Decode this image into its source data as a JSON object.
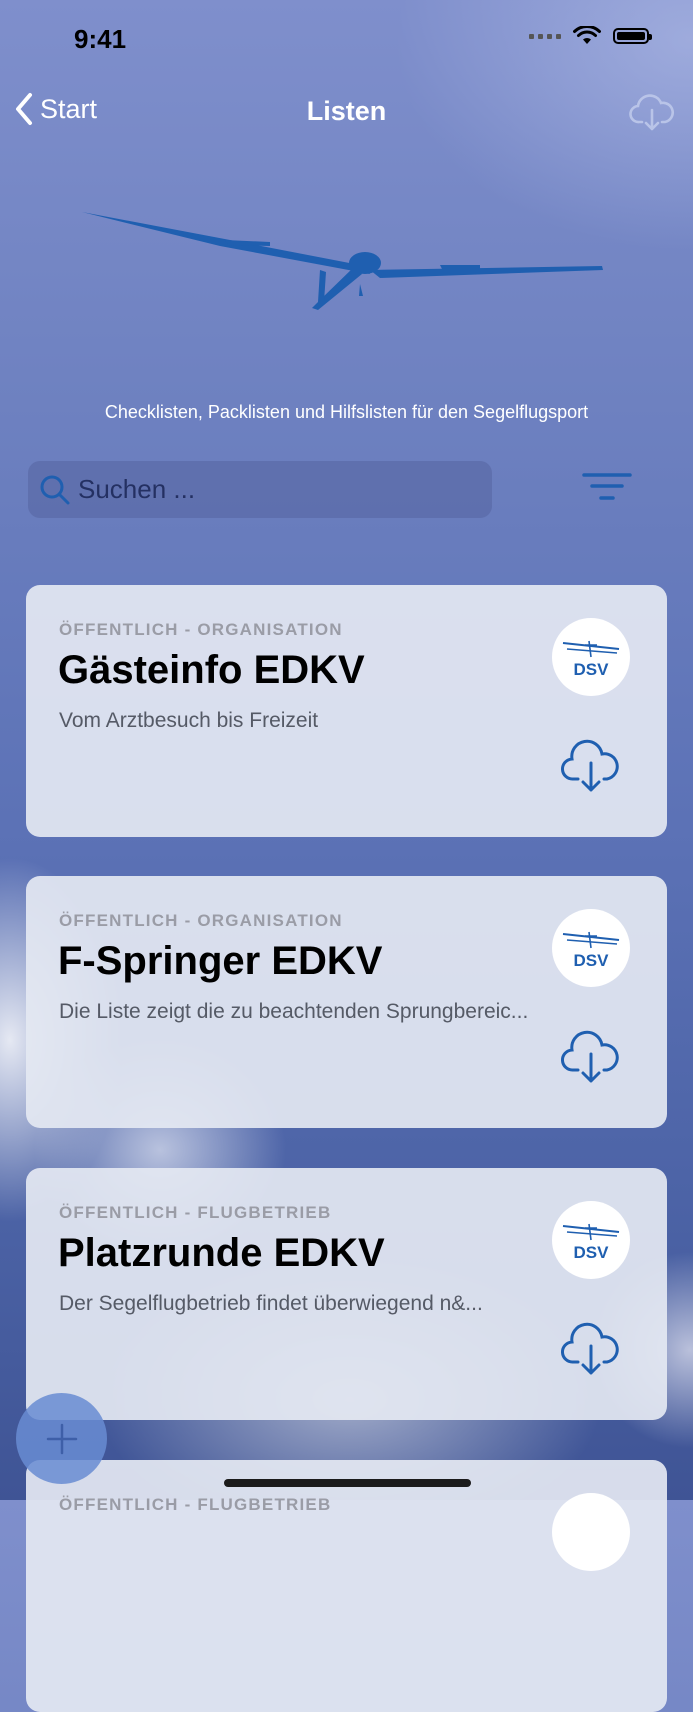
{
  "status_bar": {
    "time": "9:41"
  },
  "nav": {
    "back_label": "Start",
    "title": "Listen"
  },
  "header": {
    "tagline": "Checklisten, Packlisten und Hilfslisten für den Segelflugsport"
  },
  "search": {
    "placeholder": "Suchen ..."
  },
  "cards": [
    {
      "category": "ÖFFENTLICH - ORGANISATION",
      "title": "Gästeinfo EDKV",
      "description": "Vom Arztbesuch bis Freizeit",
      "logo_text": "DSV"
    },
    {
      "category": "ÖFFENTLICH - ORGANISATION",
      "title": "F-Springer EDKV",
      "description": "Die Liste zeigt die zu beachtenden Sprungbereic...",
      "logo_text": "DSV"
    },
    {
      "category": "ÖFFENTLICH - FLUGBETRIEB",
      "title": "Platzrunde EDKV",
      "description": "Der Segelflugbetrieb findet überwiegend n&...",
      "logo_text": "DSV"
    },
    {
      "category": "ÖFFENTLICH - FLUGBETRIEB",
      "title": "",
      "description": "",
      "logo_text": ""
    }
  ],
  "colors": {
    "accent": "#1f5fb0",
    "card_bg": "#e4e8f2"
  },
  "icons": [
    "chevron-left-icon",
    "cloud-download-icon",
    "glider-illustration",
    "search-icon",
    "filter-icon",
    "dsv-logo",
    "plus-icon"
  ]
}
